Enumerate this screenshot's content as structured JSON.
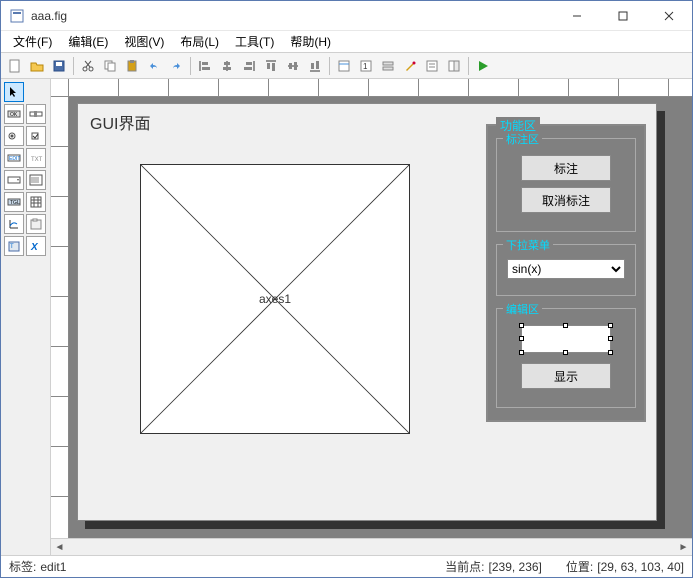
{
  "window": {
    "title": "aaa.fig"
  },
  "menu": {
    "file": "文件(F)",
    "edit": "编辑(E)",
    "view": "视图(V)",
    "layout": "布局(L)",
    "tools": "工具(T)",
    "help": "帮助(H)"
  },
  "gui": {
    "title": "GUI界面",
    "axes_label": "axes1",
    "panel_title": "功能区",
    "annotate_panel": "标注区",
    "annotate_btn": "标注",
    "unannotate_btn": "取消标注",
    "dropdown_panel": "下拉菜单",
    "dropdown_value": "sin(x)",
    "edit_panel": "编辑区",
    "show_btn": "显示"
  },
  "status": {
    "tag_label": "标签:",
    "tag_value": "edit1",
    "point_label": "当前点:",
    "point_value": "[239, 236]",
    "pos_label": "位置:",
    "pos_value": "[29, 63, 103, 40]"
  }
}
